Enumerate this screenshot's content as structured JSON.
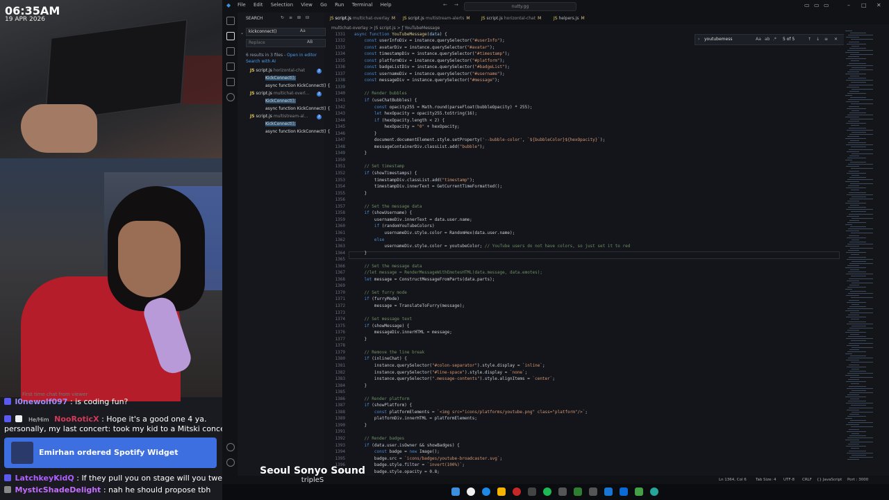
{
  "overlay": {
    "time": "06:35AM",
    "date": "19 APR 2026",
    "chat_ghost": "First time chat from viewer",
    "chat": [
      {
        "user": "l0newolf097",
        "sep": ":",
        "msg": "is coding fun?"
      },
      {
        "pronouns": "He/Him",
        "user": "NooRoticX",
        "sep": ":",
        "msg": "Hope it's a good one 4 ya."
      },
      {
        "msg": "personally, my last concert: took my kid to a Mitski concert"
      },
      {
        "user": "LatchkeyKidQ",
        "sep": ":",
        "msg": "If they pull you on stage will you twerk?"
      },
      {
        "user": "MysticShadeDelight",
        "sep": ":",
        "msg": "nah he should propose tbh"
      }
    ],
    "alert": "Emirhan ordered Spotify Widget",
    "song_title": "Seoul Sonyo Sound",
    "song_artist": "tripleS"
  },
  "ide": {
    "menu": [
      "File",
      "Edit",
      "Selection",
      "View",
      "Go",
      "Run",
      "Terminal",
      "Help"
    ],
    "title_search": "nutty.gg",
    "sidebar": {
      "title": "SEARCH",
      "search_value": "kickconnect()",
      "replace_placeholder": "Replace",
      "replace_shortcut": "AB",
      "results_summary": "6 results in 3 files",
      "open_in_editor": "Open in editor",
      "search_with_ai": "Search with AI",
      "files": [
        {
          "name": "script.js",
          "path": "horizontal-chat",
          "count": "2",
          "matches": [
            "KickConnect();",
            "async function KickConnect() {"
          ]
        },
        {
          "name": "script.js",
          "path": "multichat-overl...",
          "count": "2",
          "matches": [
            "KickConnect();",
            "async function KickConnect() {"
          ]
        },
        {
          "name": "script.js",
          "path": "multistream-al...",
          "count": "2",
          "matches": [
            "KickConnect();",
            "async function KickConnect() {"
          ]
        }
      ]
    },
    "tabs": [
      {
        "name": "script.js",
        "path": "multichat-overlay",
        "mod": "M"
      },
      {
        "name": "script.js",
        "path": "multistream-alerts",
        "mod": "M"
      },
      {
        "name": "script.js",
        "path": "horizontal-chat",
        "mod": "M"
      },
      {
        "name": "helpers.js",
        "path": "",
        "mod": "M"
      }
    ],
    "breadcrumbs": "multichat-overlay > JS script.js > ƒ YouTubeMessage",
    "find": {
      "value": "youtubemess",
      "aa": "Aa",
      "ab": "ab",
      "re": ".*",
      "result": "5 of 5"
    },
    "code": [
      {
        "n": "1332",
        "t": "    const userInfoDiv = instance.querySelector(\"#userInfo\");"
      },
      {
        "n": "1333",
        "t": "    const avatarDiv = instance.querySelector(\"#avatar\");"
      },
      {
        "n": "1334",
        "t": "    const timestampDiv = instance.querySelector(\"#timestamp\");"
      },
      {
        "n": "1335",
        "t": "    const platformDiv = instance.querySelector(\"#platform\");"
      },
      {
        "n": "1336",
        "t": "    const badgeListDiv = instance.querySelector(\"#badgeList\");"
      },
      {
        "n": "1337",
        "t": "    const usernameDiv = instance.querySelector(\"#username\");"
      },
      {
        "n": "1338",
        "t": "    const messageDiv = instance.querySelector(\"#message\");"
      },
      {
        "n": "1339",
        "t": ""
      },
      {
        "n": "1340",
        "t": "    // Render bubbles"
      },
      {
        "n": "1341",
        "t": "    if (useChatBubbles) {"
      },
      {
        "n": "1342",
        "t": "        const opacity255 = Math.round(parseFloat(bubbleOpacity) * 255);"
      },
      {
        "n": "1343",
        "t": "        let hexOpacity = opacity255.toString(16);"
      },
      {
        "n": "1344",
        "t": "        if (hexOpacity.length < 2) {"
      },
      {
        "n": "1345",
        "t": "            hexOpacity = \"0\" + hexOpacity;"
      },
      {
        "n": "1346",
        "t": "        }"
      },
      {
        "n": "1347",
        "t": "        document.documentElement.style.setProperty('--bubble-color', `${bubbleColor}${hexOpacity}`);"
      },
      {
        "n": "1348",
        "t": "        messageContainerDiv.classList.add(\"bubble\");"
      },
      {
        "n": "1349",
        "t": "    }"
      },
      {
        "n": "1350",
        "t": ""
      },
      {
        "n": "1351",
        "t": "    // Set timestamp"
      },
      {
        "n": "1352",
        "t": "    if (showTimestamps) {"
      },
      {
        "n": "1353",
        "t": "        timestampDiv.classList.add(\"timestamp\");"
      },
      {
        "n": "1354",
        "t": "        timestampDiv.innerText = GetCurrentTimeFormatted();"
      },
      {
        "n": "1355",
        "t": "    }"
      },
      {
        "n": "1356",
        "t": ""
      },
      {
        "n": "1357",
        "t": "    // Set the message data"
      },
      {
        "n": "1358",
        "t": "    if (showUsername) {"
      },
      {
        "n": "1359",
        "t": "        usernameDiv.innerText = data.user.name;"
      },
      {
        "n": "1360",
        "t": "        if (randomYouTubeColors)"
      },
      {
        "n": "1361",
        "t": "            usernameDiv.style.color = RandomHex(data.user.name);"
      },
      {
        "n": "1362",
        "t": "        else"
      },
      {
        "n": "1363",
        "t": "            usernameDiv.style.color = youtubeColor; // YouTube users do not have colors, so just set it to red"
      },
      {
        "n": "1364",
        "t": "    }"
      },
      {
        "n": "1365",
        "t": ""
      },
      {
        "n": "1366",
        "t": "    // Set the message data"
      },
      {
        "n": "1367",
        "t": "    //let message = RenderMessageWithEmotesHTML(data.message, data.emotes);"
      },
      {
        "n": "1368",
        "t": "    let message = ConstructMessageFromParts(data.parts);"
      },
      {
        "n": "1369",
        "t": ""
      },
      {
        "n": "1370",
        "t": "    // Set furry mode"
      },
      {
        "n": "1371",
        "t": "    if (furryMode)"
      },
      {
        "n": "1372",
        "t": "        message = TranslateToFurry(message);"
      },
      {
        "n": "1373",
        "t": ""
      },
      {
        "n": "1374",
        "t": "    // Set message text"
      },
      {
        "n": "1375",
        "t": "    if (showMessage) {"
      },
      {
        "n": "1376",
        "t": "        messageDiv.innerHTML = message;"
      },
      {
        "n": "1377",
        "t": "    }"
      },
      {
        "n": "1378",
        "t": ""
      },
      {
        "n": "1379",
        "t": "    // Remove the line break"
      },
      {
        "n": "1380",
        "t": "    if (inlineChat) {"
      },
      {
        "n": "1381",
        "t": "        instance.querySelector(\"#colon-separator\").style.display = `inline`;"
      },
      {
        "n": "1382",
        "t": "        instance.querySelector(\"#line-space\").style.display = `none`;"
      },
      {
        "n": "1383",
        "t": "        instance.querySelector(\".message-contents\").style.alignItems = `center`;"
      },
      {
        "n": "1384",
        "t": "    }"
      },
      {
        "n": "1385",
        "t": ""
      },
      {
        "n": "1386",
        "t": "    // Render platform"
      },
      {
        "n": "1387",
        "t": "    if (showPlatform) {"
      },
      {
        "n": "1388",
        "t": "        const platformElements = `<img src=\"icons/platforms/youtube.png\" class=\"platform\"/>`;"
      },
      {
        "n": "1389",
        "t": "        platformDiv.innerHTML = platformElements;"
      },
      {
        "n": "1390",
        "t": "    }"
      },
      {
        "n": "1391",
        "t": ""
      },
      {
        "n": "1392",
        "t": "    // Render badges"
      },
      {
        "n": "1393",
        "t": "    if (data.user.isOwner && showBadges) {"
      },
      {
        "n": "1394",
        "t": "        const badge = new Image();"
      },
      {
        "n": "1395",
        "t": "        badge.src = `icons/badges/youtube-broadcaster.svg`;"
      },
      {
        "n": "1396",
        "t": "        badge.style.filter = `invert(100%)`;"
      },
      {
        "n": "1397",
        "t": "        badge.style.opacity = 0.8;"
      }
    ],
    "fn_header": "async function YouTubeMessage(data) {",
    "fn_header_n": "1331",
    "status": {
      "position": "Ln 1364, Col 6",
      "tab_size": "Tab Size: 4",
      "encoding": "UTF-8",
      "eol": "CRLF",
      "language": "{} JavaScript",
      "port": "Port : 3000"
    }
  }
}
